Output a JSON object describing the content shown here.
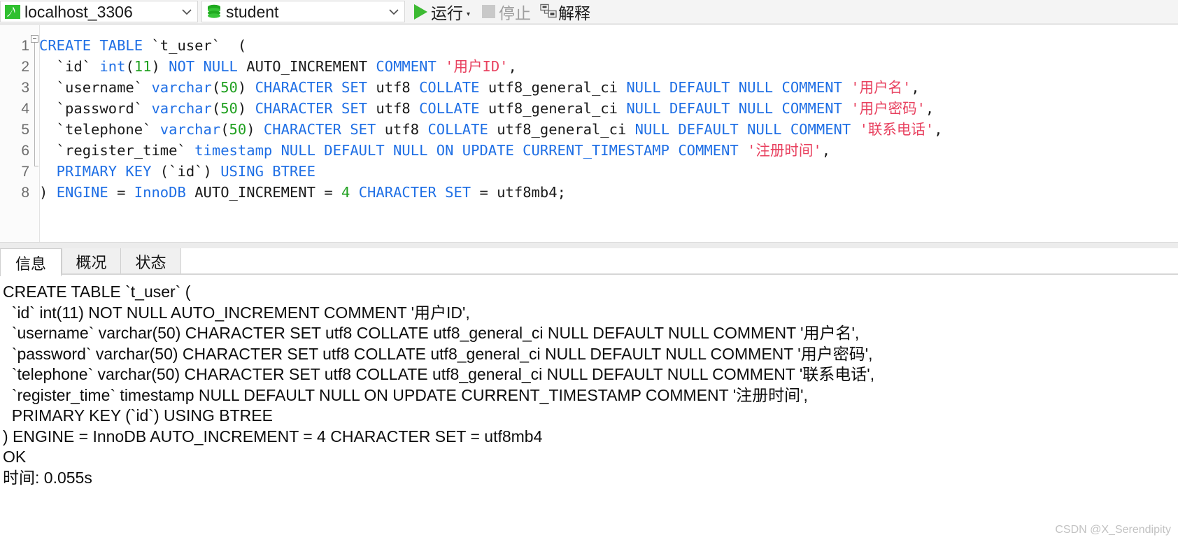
{
  "toolbar": {
    "connection": {
      "name": "localhost_3306",
      "icon": "navicat-connection-icon",
      "arrow_icon": "chevron-down-icon"
    },
    "database": {
      "name": "student",
      "icon": "database-icon",
      "arrow_icon": "chevron-down-icon"
    },
    "run_button": {
      "label": "运行",
      "icon": "play-icon",
      "caret": "▾",
      "enabled": true
    },
    "stop_button": {
      "label": "停止",
      "icon": "stop-icon",
      "enabled": false
    },
    "explain_button": {
      "label": "解释",
      "icon": "explain-icon",
      "enabled": true
    }
  },
  "editor": {
    "lines": [
      {
        "number": "1",
        "fold": "open",
        "tokens": [
          {
            "t": "CREATE TABLE ",
            "c": "kw"
          },
          {
            "t": "`t_user`  (",
            "c": "pl"
          }
        ]
      },
      {
        "number": "2",
        "fold": "mid",
        "tokens": [
          {
            "t": "  `id` ",
            "c": "pl"
          },
          {
            "t": "int",
            "c": "kw"
          },
          {
            "t": "(",
            "c": "pl"
          },
          {
            "t": "11",
            "c": "num"
          },
          {
            "t": ") ",
            "c": "pl"
          },
          {
            "t": "NOT NULL ",
            "c": "kw"
          },
          {
            "t": "AUTO_INCREMENT ",
            "c": "pl"
          },
          {
            "t": "COMMENT ",
            "c": "kw"
          },
          {
            "t": "'用户ID'",
            "c": "str"
          },
          {
            "t": ",",
            "c": "pl"
          }
        ]
      },
      {
        "number": "3",
        "fold": "mid",
        "tokens": [
          {
            "t": "  `username` ",
            "c": "pl"
          },
          {
            "t": "varchar",
            "c": "kw"
          },
          {
            "t": "(",
            "c": "pl"
          },
          {
            "t": "50",
            "c": "num"
          },
          {
            "t": ") ",
            "c": "pl"
          },
          {
            "t": "CHARACTER SET ",
            "c": "kw"
          },
          {
            "t": "utf8 ",
            "c": "pl"
          },
          {
            "t": "COLLATE ",
            "c": "kw"
          },
          {
            "t": "utf8_general_ci ",
            "c": "pl"
          },
          {
            "t": "NULL DEFAULT NULL COMMENT ",
            "c": "kw"
          },
          {
            "t": "'用户名'",
            "c": "str"
          },
          {
            "t": ",",
            "c": "pl"
          }
        ]
      },
      {
        "number": "4",
        "fold": "mid",
        "tokens": [
          {
            "t": "  `password` ",
            "c": "pl"
          },
          {
            "t": "varchar",
            "c": "kw"
          },
          {
            "t": "(",
            "c": "pl"
          },
          {
            "t": "50",
            "c": "num"
          },
          {
            "t": ") ",
            "c": "pl"
          },
          {
            "t": "CHARACTER SET ",
            "c": "kw"
          },
          {
            "t": "utf8 ",
            "c": "pl"
          },
          {
            "t": "COLLATE ",
            "c": "kw"
          },
          {
            "t": "utf8_general_ci ",
            "c": "pl"
          },
          {
            "t": "NULL DEFAULT NULL COMMENT ",
            "c": "kw"
          },
          {
            "t": "'用户密码'",
            "c": "str"
          },
          {
            "t": ",",
            "c": "pl"
          }
        ]
      },
      {
        "number": "5",
        "fold": "mid",
        "tokens": [
          {
            "t": "  `telephone` ",
            "c": "pl"
          },
          {
            "t": "varchar",
            "c": "kw"
          },
          {
            "t": "(",
            "c": "pl"
          },
          {
            "t": "50",
            "c": "num"
          },
          {
            "t": ") ",
            "c": "pl"
          },
          {
            "t": "CHARACTER SET ",
            "c": "kw"
          },
          {
            "t": "utf8 ",
            "c": "pl"
          },
          {
            "t": "COLLATE ",
            "c": "kw"
          },
          {
            "t": "utf8_general_ci ",
            "c": "pl"
          },
          {
            "t": "NULL DEFAULT NULL COMMENT ",
            "c": "kw"
          },
          {
            "t": "'联系电话'",
            "c": "str"
          },
          {
            "t": ",",
            "c": "pl"
          }
        ]
      },
      {
        "number": "6",
        "fold": "mid",
        "tokens": [
          {
            "t": "  `register_time` ",
            "c": "pl"
          },
          {
            "t": "timestamp NULL DEFAULT NULL ON UPDATE CURRENT_TIMESTAMP COMMENT ",
            "c": "kw"
          },
          {
            "t": "'注册时间'",
            "c": "str"
          },
          {
            "t": ",",
            "c": "pl"
          }
        ]
      },
      {
        "number": "7",
        "fold": "end",
        "tokens": [
          {
            "t": "  PRIMARY KEY ",
            "c": "kw"
          },
          {
            "t": "(`id`) ",
            "c": "pl"
          },
          {
            "t": "USING BTREE",
            "c": "kw"
          }
        ]
      },
      {
        "number": "8",
        "fold": "none",
        "tokens": [
          {
            "t": ") ",
            "c": "pl"
          },
          {
            "t": "ENGINE ",
            "c": "kw"
          },
          {
            "t": "= ",
            "c": "pl"
          },
          {
            "t": "InnoDB ",
            "c": "kw"
          },
          {
            "t": "AUTO_INCREMENT = ",
            "c": "pl"
          },
          {
            "t": "4",
            "c": "num"
          },
          {
            "t": " CHARACTER SET ",
            "c": "kw"
          },
          {
            "t": "= utf8mb4;",
            "c": "pl"
          }
        ]
      }
    ]
  },
  "result_tabs": [
    {
      "label": "信息",
      "active": true
    },
    {
      "label": "概况",
      "active": false
    },
    {
      "label": "状态",
      "active": false
    }
  ],
  "output_lines": [
    "CREATE TABLE `t_user` (",
    "  `id` int(11) NOT NULL AUTO_INCREMENT COMMENT '用户ID',",
    "  `username` varchar(50) CHARACTER SET utf8 COLLATE utf8_general_ci NULL DEFAULT NULL COMMENT '用户名',",
    "  `password` varchar(50) CHARACTER SET utf8 COLLATE utf8_general_ci NULL DEFAULT NULL COMMENT '用户密码',",
    "  `telephone` varchar(50) CHARACTER SET utf8 COLLATE utf8_general_ci NULL DEFAULT NULL COMMENT '联系电话',",
    "  `register_time` timestamp NULL DEFAULT NULL ON UPDATE CURRENT_TIMESTAMP COMMENT '注册时间',",
    "  PRIMARY KEY (`id`) USING BTREE",
    ") ENGINE = InnoDB AUTO_INCREMENT = 4 CHARACTER SET = utf8mb4",
    "OK",
    "时间: 0.055s"
  ],
  "watermark": "CSDN @X_Serendipity",
  "colors": {
    "keyword": "#1f6fe5",
    "number": "#20a020",
    "string": "#e8415f",
    "plain": "#1a1a1a",
    "run_green": "#3cba32",
    "toolbar_bg": "#f4f4f4"
  }
}
